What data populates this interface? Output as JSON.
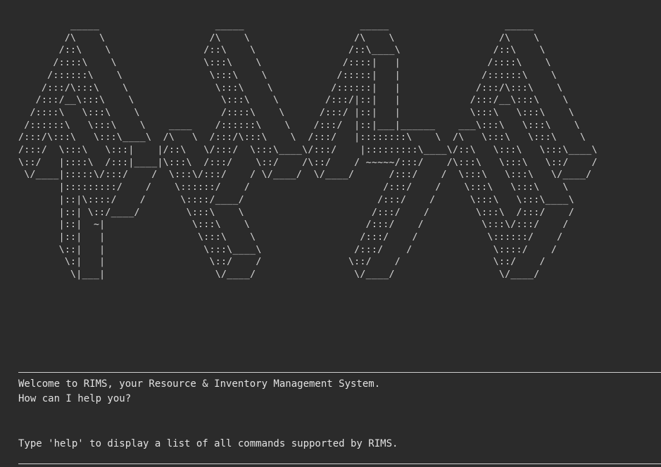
{
  "terminal": {
    "background": "#2b2b2b",
    "foreground": "#d6d6d6",
    "ascii_logo": "         _____                    _____                    _____                    _____\n        /\\    \\                  /\\    \\                  /\\    \\                  /\\    \\\n       /::\\    \\                /::\\    \\                /::\\____\\                /::\\    \\\n      /::::\\    \\               \\:::\\    \\              /::::|   |               /::::\\    \\\n     /::::::\\    \\               \\:::\\    \\            /:::::|   |              /::::::\\    \\\n    /:::/\\:::\\    \\               \\:::\\    \\          /::::::|   |             /:::/\\:::\\    \\\n   /:::/__\\:::\\    \\               \\:::\\    \\        /:::/|::|   |            /:::/__\\:::\\    \\\n  /::::\\   \\:::\\    \\              /::::\\    \\      /:::/ |::|   |            \\:::\\   \\:::\\    \\\n /::::::\\   \\:::\\    \\    ____    /::::::\\    \\    /:::/  |::|___|______    ___\\:::\\   \\:::\\    \\\n/:::/\\:::\\   \\:::\\____\\  /\\   \\  /:::/\\:::\\    \\  /:::/   |::::::::\\    \\  /\\   \\:::\\   \\:::\\    \\\n/:::/  \\:::\\   \\:::|    |/::\\   \\/:::/  \\:::\\____\\/:::/    |:::::::::\\____\\/::\\   \\:::\\   \\:::\\____\\\n\\::/   |::::\\  /:::|____|\\:::\\  /:::/    \\::/    /\\::/    / ~~~~~/:::/    /\\:::\\   \\:::\\   \\::/    /\n \\/____|:::::\\/:::/    /  \\:::\\/:::/    / \\/____/  \\/____/      /:::/    /  \\:::\\   \\:::\\   \\/____/\n       |:::::::::/    /    \\::::::/    /                       /:::/    /    \\:::\\   \\:::\\    \\\n       |::|\\::::/    /      \\::::/____/                       /:::/    /      \\:::\\   \\:::\\____\\\n       |::| \\::/____/        \\:::\\    \\                      /:::/    /        \\:::\\  /:::/    /\n       |::|  ~|               \\:::\\    \\                    /:::/    /          \\:::\\/:::/    /\n       |::|   |                \\:::\\    \\                  /:::/    /            \\::::::/    /\n       \\::|   |                 \\:::\\____\\                /:::/    /              \\::::/    /\n        \\:|   |                  \\::/    /               \\::/    /                \\::/    /\n         \\|___|                   \\/____/                 \\/____/                  \\/____/",
    "welcome_message": "Welcome to RIMS, your Resource & Inventory Management System.",
    "help_prompt": "How can I help you?",
    "hint_message": "Type 'help' to display a list of all commands supported by RIMS."
  }
}
